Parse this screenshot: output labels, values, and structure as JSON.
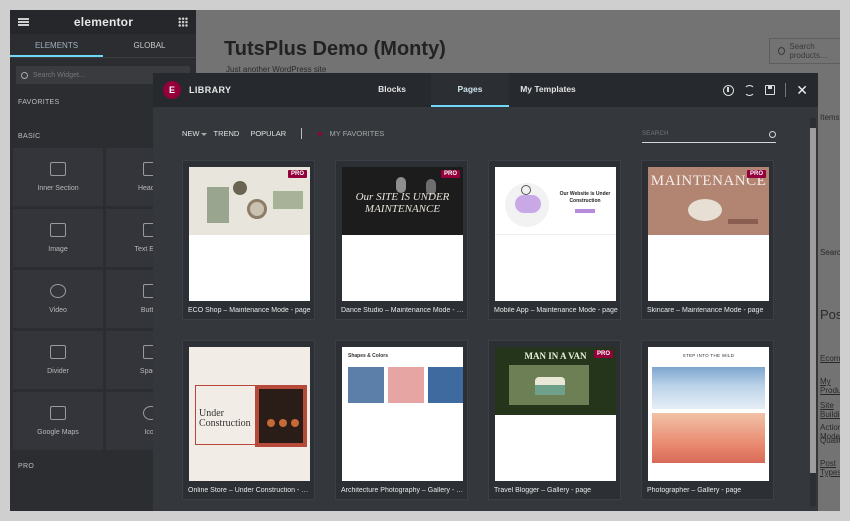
{
  "editor": {
    "logo": "elementor",
    "tabs": [
      "ELEMENTS",
      "GLOBAL"
    ],
    "search_placeholder": "Search Widget...",
    "favorites_title": "FAVORITES",
    "basic_title": "BASIC",
    "pro_title": "PRO",
    "widgets": [
      "Inner Section",
      "Heading",
      "Image",
      "Text Editor",
      "Video",
      "Button",
      "Divider",
      "Spacer",
      "Google Maps",
      "Icon"
    ]
  },
  "page": {
    "title": "TutsPlus Demo (Monty)",
    "subtitle": "Just another WordPress site",
    "search_placeholder": "Search products…",
    "right_snippets": [
      "Items",
      "Search",
      "Posts",
      "Ecommerce",
      "My Products",
      "Site Building",
      "Action Mode",
      "Quality",
      "Post Types"
    ]
  },
  "library": {
    "title": "LIBRARY",
    "tabs": [
      "Blocks",
      "Pages",
      "My Templates"
    ],
    "active_tab": "Pages",
    "filters": {
      "new": "NEW",
      "trend": "TREND",
      "popular": "POPULAR",
      "favorites": "MY FAVORITES"
    },
    "search_placeholder": "SEARCH",
    "pro_badge": "PRO",
    "templates": [
      {
        "name": "ECO Shop – Maintenance Mode - page",
        "pro": true,
        "hero_color": "#e8e5dc",
        "hero_title": ""
      },
      {
        "name": "Dance Studio – Maintenance Mode - page",
        "pro": true,
        "hero_color": "#1c1c1c",
        "hero_title": "Our SITE IS UNDER MAINTENANCE"
      },
      {
        "name": "Mobile App – Maintenance Mode - page",
        "pro": false,
        "hero_color": "#ffffff",
        "hero_title": "Our Website is Under Construction"
      },
      {
        "name": "Skincare – Maintenance Mode - page",
        "pro": true,
        "hero_color": "#b28472",
        "hero_title": "MAINTENANCE"
      },
      {
        "name": "Online Store – Under Construction - page",
        "pro": false,
        "hero_color": "#f1ece6",
        "hero_title": "Under Construction"
      },
      {
        "name": "Architecture Photography – Gallery - page",
        "pro": false,
        "hero_color": "#ffffff",
        "hero_title": "Shapes & Colors"
      },
      {
        "name": "Travel Blogger – Gallery - page",
        "pro": true,
        "hero_color": "#24351b",
        "hero_title": "MAN IN A VAN"
      },
      {
        "name": "Photographer – Gallery - page",
        "pro": false,
        "hero_color": "#ffffff",
        "hero_title": "STEP INTO THE WILD"
      }
    ]
  }
}
